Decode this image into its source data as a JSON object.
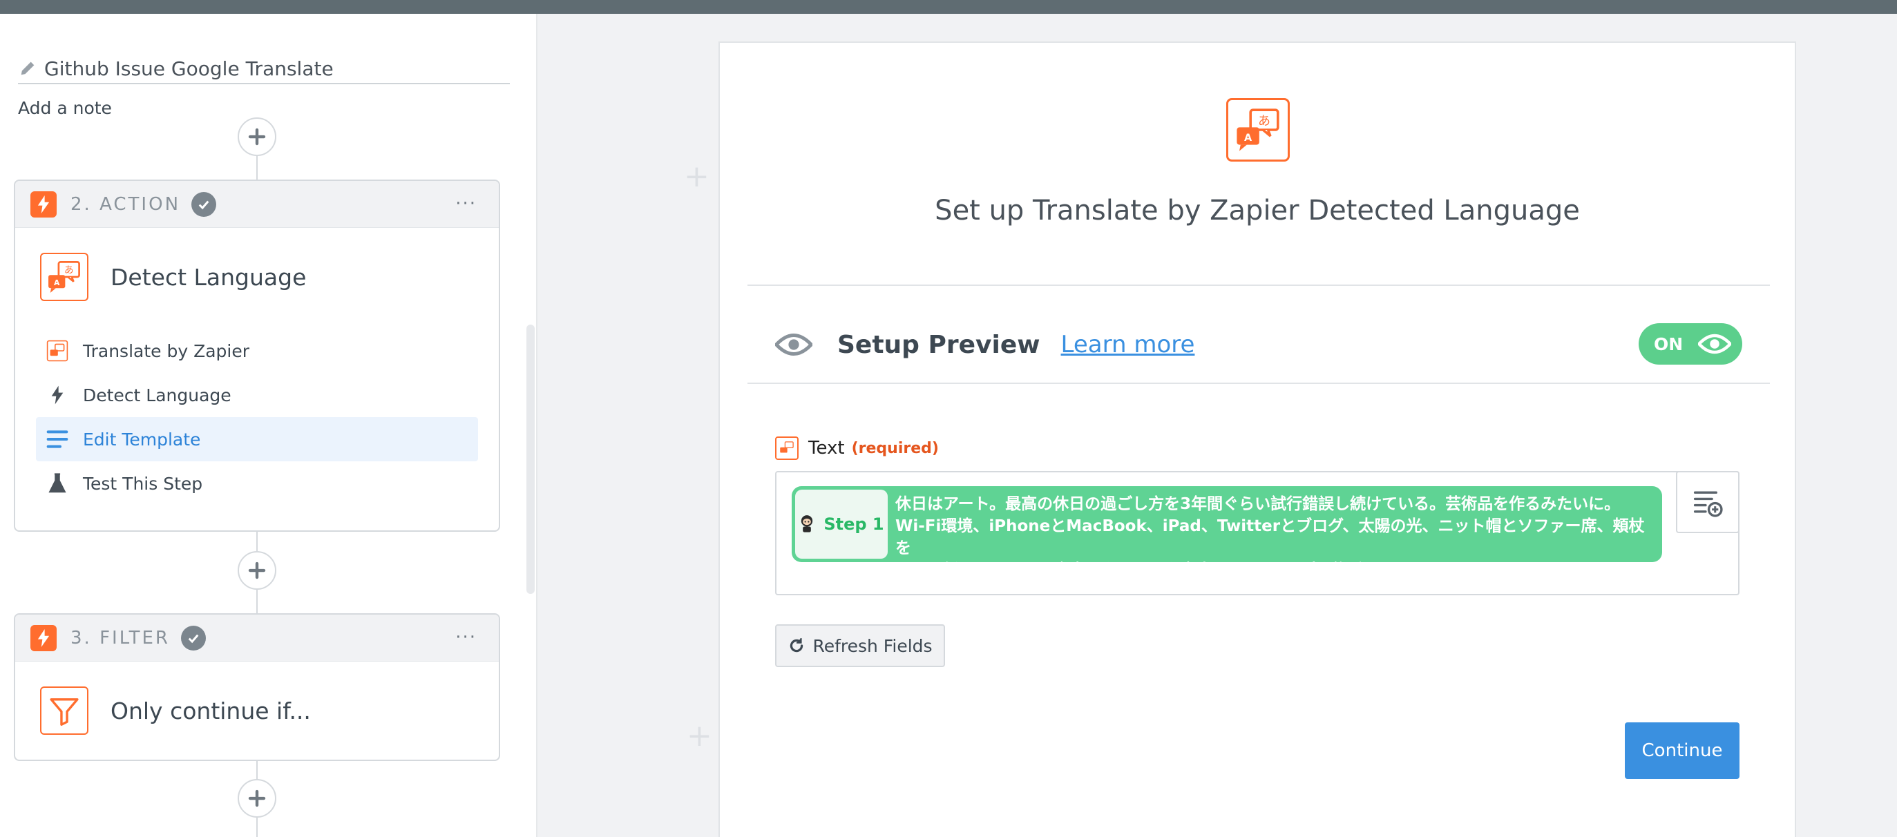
{
  "sidebar": {
    "zap_name": "Github Issue Google Translate",
    "add_note": "Add a note",
    "action_step": {
      "label": "2. ACTION",
      "app_name": "Detect Language",
      "menu": [
        {
          "label": "Translate by Zapier",
          "icon": "translate-app-icon"
        },
        {
          "label": "Detect Language",
          "icon": "bolt-icon"
        },
        {
          "label": "Edit Template",
          "icon": "template-lines-icon",
          "active": true
        },
        {
          "label": "Test This Step",
          "icon": "flask-icon"
        }
      ]
    },
    "filter_step": {
      "label": "3. FILTER",
      "app_name": "Only continue if..."
    },
    "more_dots": "···"
  },
  "main": {
    "title": "Set up Translate by Zapier Detected Language",
    "preview": {
      "label": "Setup Preview",
      "learn_more": "Learn more",
      "toggle": "ON"
    },
    "field": {
      "label": "Text",
      "required": "(required)",
      "step_pill": "Step 1",
      "value": "休日はアート。最高の休日の過ごし方を3年間ぐらい試行錯誤し続けている。芸術品を作るみたいに。\nWi-Fi環境、iPhoneとMacBook、iPad、Twitterとブログ、太陽の光、ニット帽とソファー席、頬杖を\nついて仮眠、おいしい食事、クラシック音楽、すべての要素が調和せよ。"
    },
    "refresh": "Refresh Fields",
    "continue": "Continue"
  },
  "colors": {
    "accent_orange": "#ff6d2e",
    "accent_blue": "#3a90e0",
    "accent_green": "#5fd394"
  }
}
